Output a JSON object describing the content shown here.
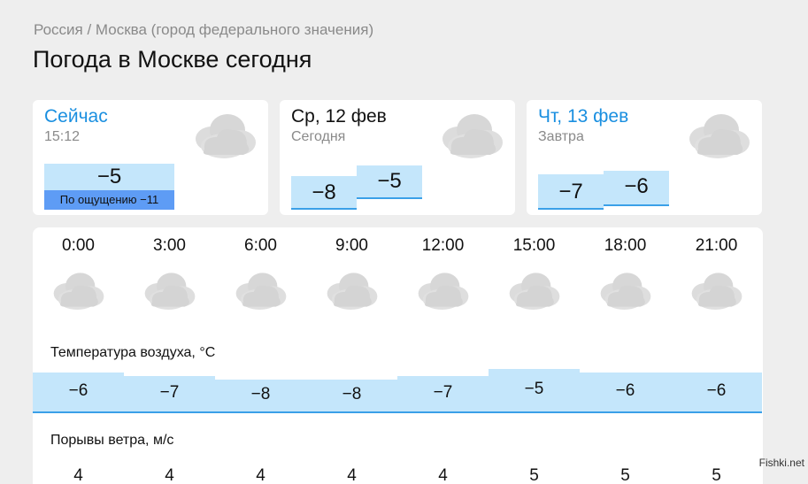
{
  "breadcrumb": "Россия / Москва (город федерального значения)",
  "page_title": "Погода в Москве сегодня",
  "colors": {
    "accent": "#1a8fe0",
    "temp_fill": "#c4e6fb",
    "temp_line": "#3aa0e8",
    "feels_fill": "#5e9cf5",
    "cloud": "#d9d9d9"
  },
  "now": {
    "title": "Сейчас",
    "time": "15:12",
    "temp": "−5",
    "feels_like": "По ощущению −11",
    "icon": "cloudy-icon"
  },
  "today": {
    "title": "Ср, 12 фев",
    "subtitle": "Сегодня",
    "temp_night": "−8",
    "temp_day": "−5",
    "icon": "cloudy-icon"
  },
  "tomorrow": {
    "title": "Чт, 13 фев",
    "subtitle": "Завтра",
    "temp_night": "−7",
    "temp_day": "−6",
    "icon": "cloudy-icon"
  },
  "hourly": {
    "hours": [
      "0:00",
      "3:00",
      "6:00",
      "9:00",
      "12:00",
      "15:00",
      "18:00",
      "21:00"
    ],
    "icons": [
      "cloudy-icon",
      "cloudy-icon",
      "cloudy-icon",
      "cloudy-icon",
      "cloudy-icon",
      "cloudy-icon",
      "cloudy-icon",
      "cloudy-icon"
    ],
    "temp_label": "Температура воздуха, °С",
    "temps": [
      "−6",
      "−7",
      "−8",
      "−8",
      "−7",
      "−5",
      "−6",
      "−6"
    ],
    "temps_values": [
      -6,
      -7,
      -8,
      -8,
      -7,
      -5,
      -6,
      -6
    ],
    "gust_label": "Порывы ветра, м/с",
    "gusts": [
      "4",
      "4",
      "4",
      "4",
      "4",
      "5",
      "5",
      "5"
    ]
  },
  "watermark": "Fishki.net"
}
